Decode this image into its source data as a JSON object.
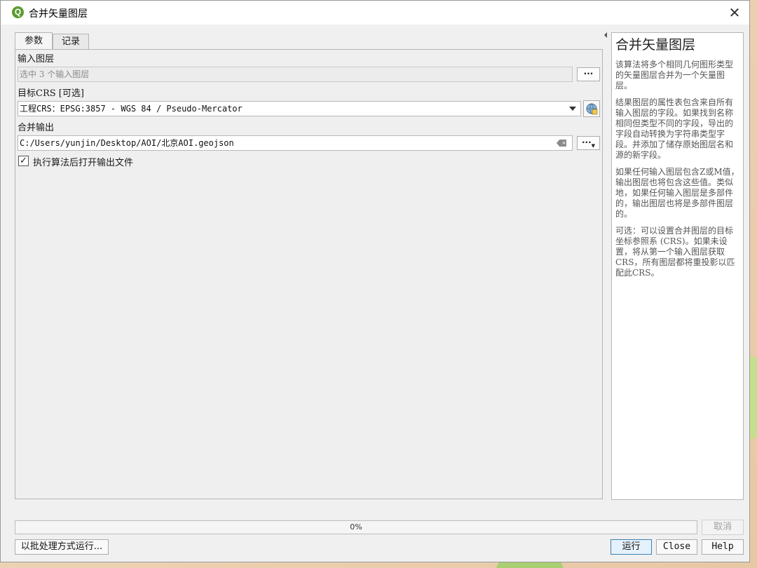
{
  "window": {
    "title": "合并矢量图层"
  },
  "tabs": [
    {
      "label": "参数"
    },
    {
      "label": "记录"
    }
  ],
  "params": {
    "input_layers": {
      "label": "输入图层",
      "value": "选中 3 个输入图层",
      "button_label": "···"
    },
    "target_crs": {
      "label": "目标CRS [可选]",
      "value": "工程CRS：EPSG:3857 - WGS 84 / Pseudo-Mercator"
    },
    "merged_output": {
      "label": "合并输出",
      "value": "C:/Users/yunjin/Desktop/AOI/北京AOI.geojson",
      "button_label": "···"
    },
    "open_output": {
      "label": "执行算法后打开输出文件",
      "checked": true,
      "check_glyph": "✓"
    }
  },
  "help": {
    "title": "合并矢量图层",
    "paragraphs": [
      "该算法将多个相同几何图形类型的矢量图层合并为一个矢量图层。",
      "结果图层的属性表包含来自所有输入图层的字段。如果找到名称相同但类型不同的字段，导出的字段自动转换为字符串类型字段。并添加了储存原始图层名和源的新字段。",
      "如果任何输入图层包含Z或M值，输出图层也将包含这些值。类似地，如果任何输入图层是多部件的，输出图层也将是多部件图层的。",
      "可选：可以设置合并图层的目标坐标参照系 (CRS)。如果未设置，将从第一个输入图层获取CRS，所有图层都将重投影以匹配此CRS。"
    ]
  },
  "progress": {
    "value": 0,
    "text": "0%"
  },
  "buttons": {
    "cancel": "取消",
    "batch": "以批处理方式运行...",
    "run": "运行",
    "close": "Close",
    "help": "Help"
  },
  "icons": {
    "app": "qgis-icon",
    "close": "close-icon",
    "crs": "crs-globe-icon",
    "clear": "clear-icon",
    "collapse": "collapse-arrow-icon"
  },
  "colors": {
    "accent": "#3c7fb1",
    "progress": "#06b025",
    "app_icon": "#5c9b2f"
  }
}
